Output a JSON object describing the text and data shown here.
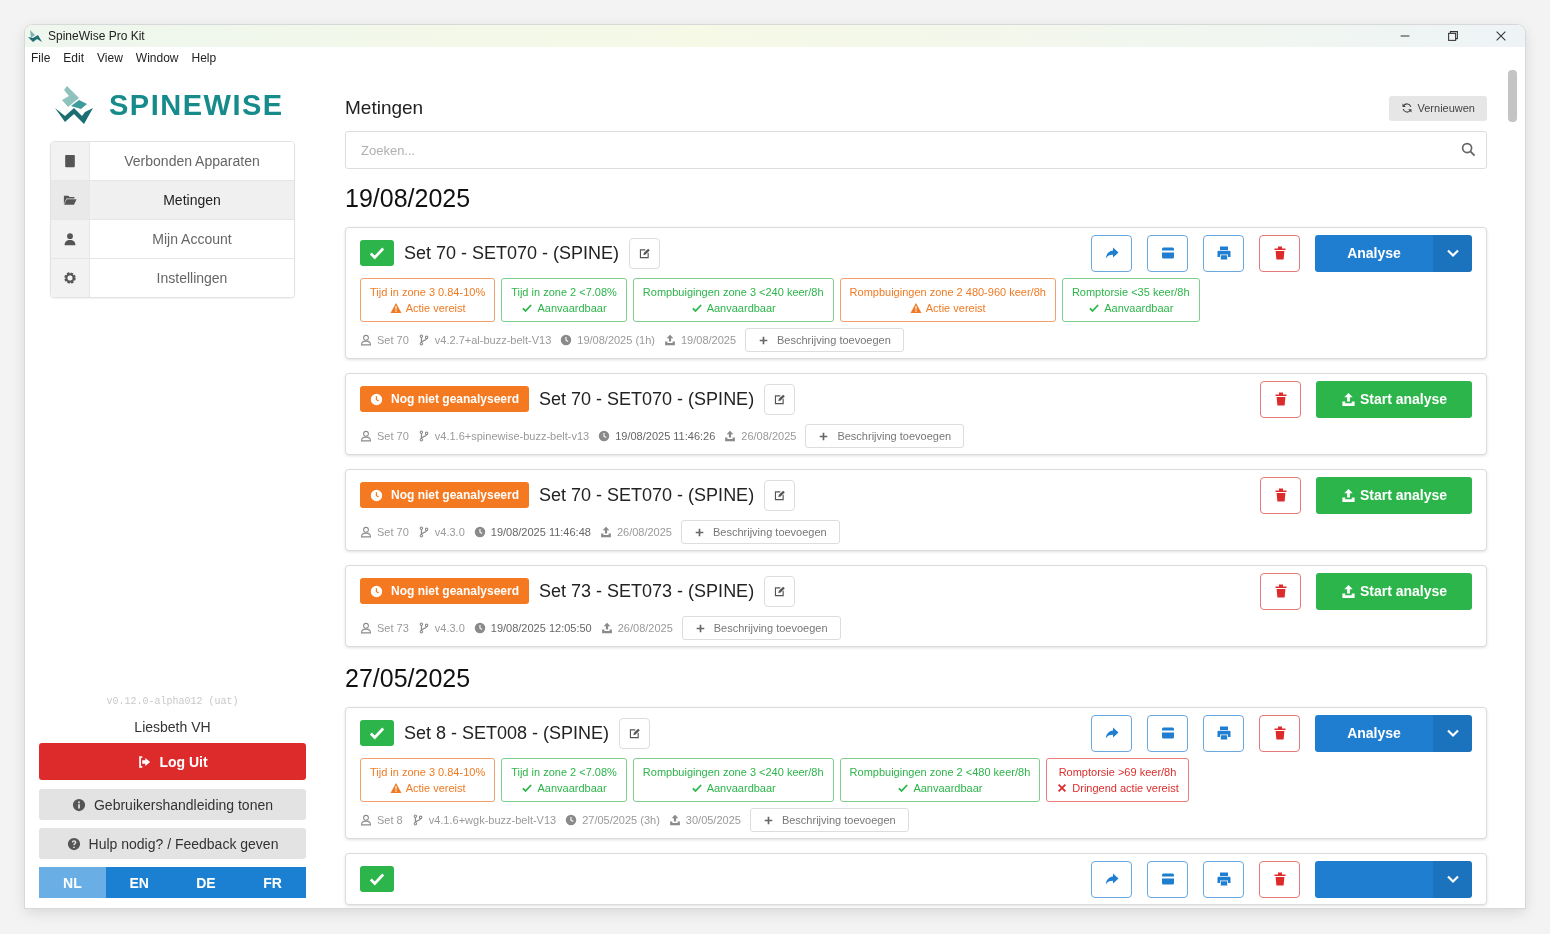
{
  "window": {
    "title": "SpineWise Pro Kit"
  },
  "menu": [
    "File",
    "Edit",
    "View",
    "Window",
    "Help"
  ],
  "sidebar": {
    "logo": "SPINEWISE",
    "nav": [
      {
        "label": "Verbonden Apparaten",
        "selected": false
      },
      {
        "label": "Metingen",
        "selected": true
      },
      {
        "label": "Mijn Account",
        "selected": false
      },
      {
        "label": "Instellingen",
        "selected": false
      }
    ],
    "version": "v0.12.0-alpha012 (uat)",
    "user": "Liesbeth VH",
    "logout": "Log Uit",
    "links": [
      {
        "label": "Gebruikershandleiding tonen"
      },
      {
        "label": "Hulp nodig? / Feedback geven"
      }
    ],
    "languages": [
      {
        "label": "NL",
        "selected": true
      },
      {
        "label": "EN",
        "selected": false
      },
      {
        "label": "DE",
        "selected": false
      },
      {
        "label": "FR",
        "selected": false
      }
    ]
  },
  "main": {
    "title": "Metingen",
    "refresh": "Vernieuwen",
    "search": {
      "placeholder": "Zoeken..."
    },
    "groups": [
      {
        "date": "19/08/2025",
        "items": [
          {
            "kind": "analysed",
            "title": "Set 70 - SET070 - (SPINE)",
            "action": "Analyse",
            "metrics": [
              {
                "label": "Tijd in zone 3 0.84-10%",
                "result": "Actie vereist",
                "kind": "warning"
              },
              {
                "label": "Tijd in zone 2 <7.08%",
                "result": "Aanvaardbaar",
                "kind": "ok"
              },
              {
                "label": "Rompbuigingen zone 3 <240 keer/8h",
                "result": "Aanvaardbaar",
                "kind": "ok"
              },
              {
                "label": "Rompbuigingen zone 2 480-960 keer/8h",
                "result": "Actie vereist",
                "kind": "warning"
              },
              {
                "label": "Romptorsie <35 keer/8h",
                "result": "Aanvaardbaar",
                "kind": "ok"
              }
            ],
            "meta": {
              "set": "Set 70",
              "version": "v4.2.7+al-buzz-belt-V13",
              "recorded": "19/08/2025 (1h)",
              "uploaded": "19/08/2025"
            },
            "add_description": "Beschrijving toevoegen"
          },
          {
            "kind": "pending",
            "status": "Nog niet geanalyseerd",
            "title": "Set 70 - SET070 - (SPINE)",
            "action": "Start analyse",
            "meta": {
              "set": "Set 70",
              "version": "v4.1.6+spinewise-buzz-belt-v13",
              "recorded": "19/08/2025 11:46:26",
              "uploaded": "26/08/2025"
            },
            "add_description": "Beschrijving toevoegen"
          },
          {
            "kind": "pending",
            "status": "Nog niet geanalyseerd",
            "title": "Set 70 - SET070 - (SPINE)",
            "action": "Start analyse",
            "meta": {
              "set": "Set 70",
              "version": "v4.3.0",
              "recorded": "19/08/2025 11:46:48",
              "uploaded": "26/08/2025"
            },
            "add_description": "Beschrijving toevoegen"
          },
          {
            "kind": "pending",
            "status": "Nog niet geanalyseerd",
            "title": "Set 73 - SET073 - (SPINE)",
            "action": "Start analyse",
            "meta": {
              "set": "Set 73",
              "version": "v4.3.0",
              "recorded": "19/08/2025 12:05:50",
              "uploaded": "26/08/2025"
            },
            "add_description": "Beschrijving toevoegen"
          }
        ]
      },
      {
        "date": "27/05/2025",
        "items": [
          {
            "kind": "analysed",
            "title": "Set 8 - SET008 - (SPINE)",
            "action": "Analyse",
            "metrics": [
              {
                "label": "Tijd in zone 3 0.84-10%",
                "result": "Actie vereist",
                "kind": "warning"
              },
              {
                "label": "Tijd in zone 2 <7.08%",
                "result": "Aanvaardbaar",
                "kind": "ok"
              },
              {
                "label": "Rompbuigingen zone 3 <240 keer/8h",
                "result": "Aanvaardbaar",
                "kind": "ok"
              },
              {
                "label": "Rompbuigingen zone 2 <480 keer/8h",
                "result": "Aanvaardbaar",
                "kind": "ok"
              },
              {
                "label": "Romptorsie >69 keer/8h",
                "result": "Dringend actie vereist",
                "kind": "danger"
              }
            ],
            "meta": {
              "set": "Set 8",
              "version": "v4.1.6+wgk-buzz-belt-V13",
              "recorded": "27/05/2025 (3h)",
              "uploaded": "30/05/2025"
            },
            "add_description": "Beschrijving toevoegen"
          },
          {
            "kind": "analysed"
          }
        ]
      }
    ]
  }
}
